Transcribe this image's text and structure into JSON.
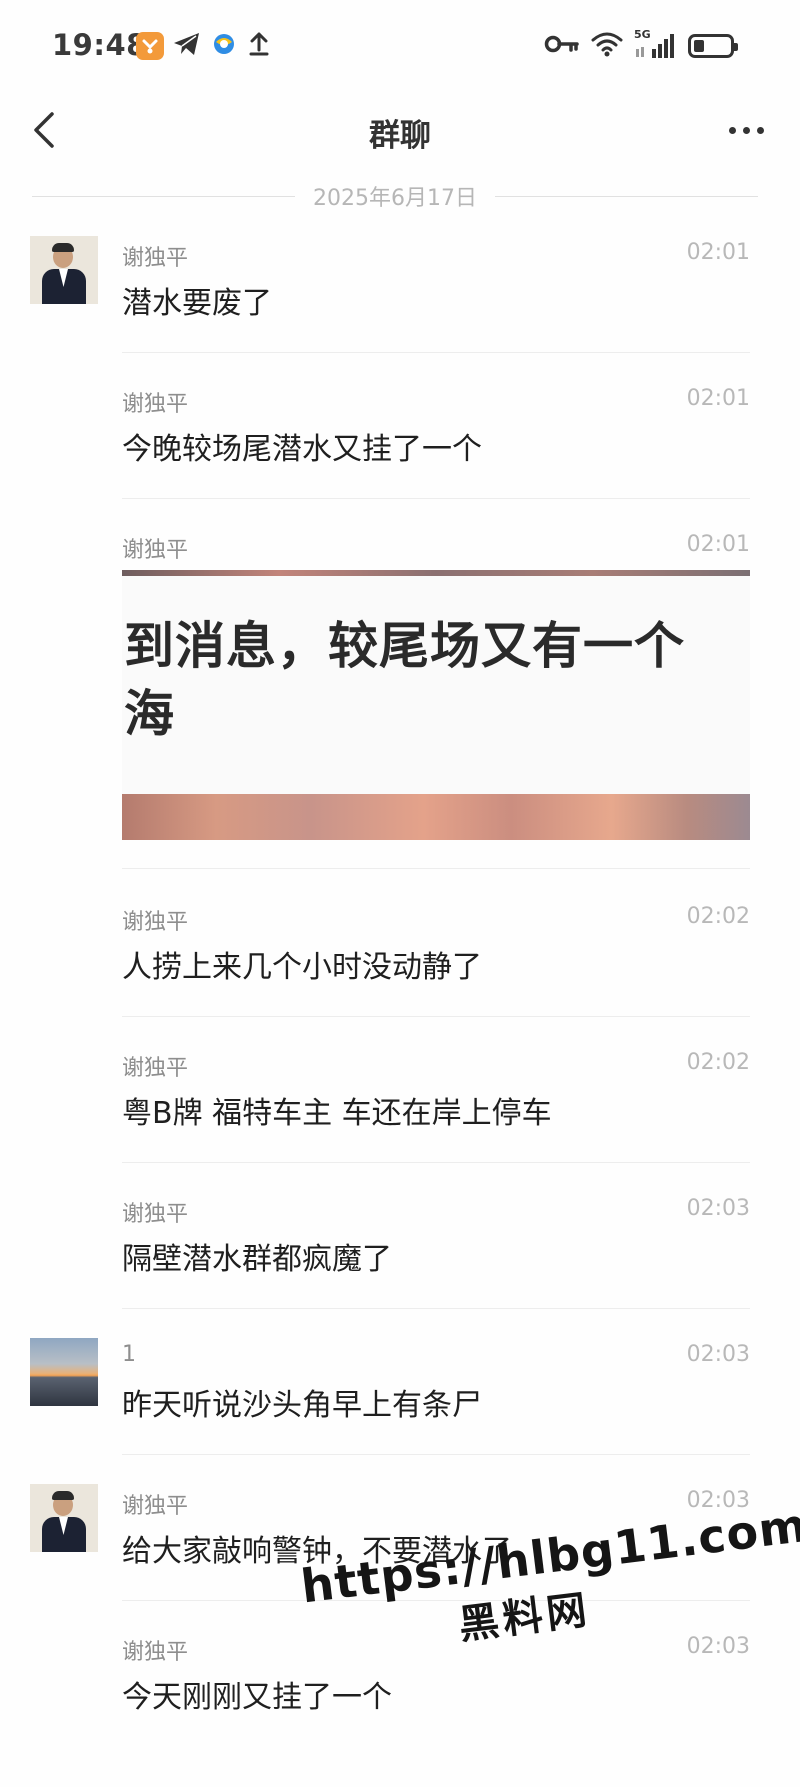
{
  "status_bar": {
    "time": "19:48",
    "network": "5G",
    "left_icons": [
      "app-badge-icon",
      "telegram-icon",
      "browser-icon",
      "upload-icon"
    ],
    "right_icons": [
      "key-icon",
      "wifi-icon",
      "signal-icon",
      "battery-icon"
    ],
    "battery_level": 0.3
  },
  "header": {
    "title": "群聊"
  },
  "date_divider": "2025年6月17日",
  "messages": [
    {
      "sender": "谢独平",
      "time": "02:01",
      "text": "潜水要废了"
    },
    {
      "sender": "谢独平",
      "time": "02:01",
      "text": "今晚较场尾潜水又挂了一个"
    },
    {
      "sender": "谢独平",
      "time": "02:01",
      "image_text": [
        "到消息，较尾场又有一个",
        "海"
      ]
    },
    {
      "sender": "谢独平",
      "time": "02:02",
      "text": "人捞上来几个小时没动静了"
    },
    {
      "sender": "谢独平",
      "time": "02:02",
      "text": "粤B牌 福特车主 车还在岸上停车"
    },
    {
      "sender": "谢独平",
      "time": "02:03",
      "text": "隔壁潜水群都疯魔了"
    },
    {
      "sender": "1",
      "time": "02:03",
      "text": "昨天听说沙头角早上有条尸"
    },
    {
      "sender": "谢独平",
      "time": "02:03",
      "text": "给大家敲响警钟，不要潜水了"
    },
    {
      "sender": "谢独平",
      "time": "02:03",
      "text": "今天刚刚又挂了一个"
    }
  ],
  "watermark": {
    "url": "https://hlbg11.com",
    "name": "黑料网"
  }
}
